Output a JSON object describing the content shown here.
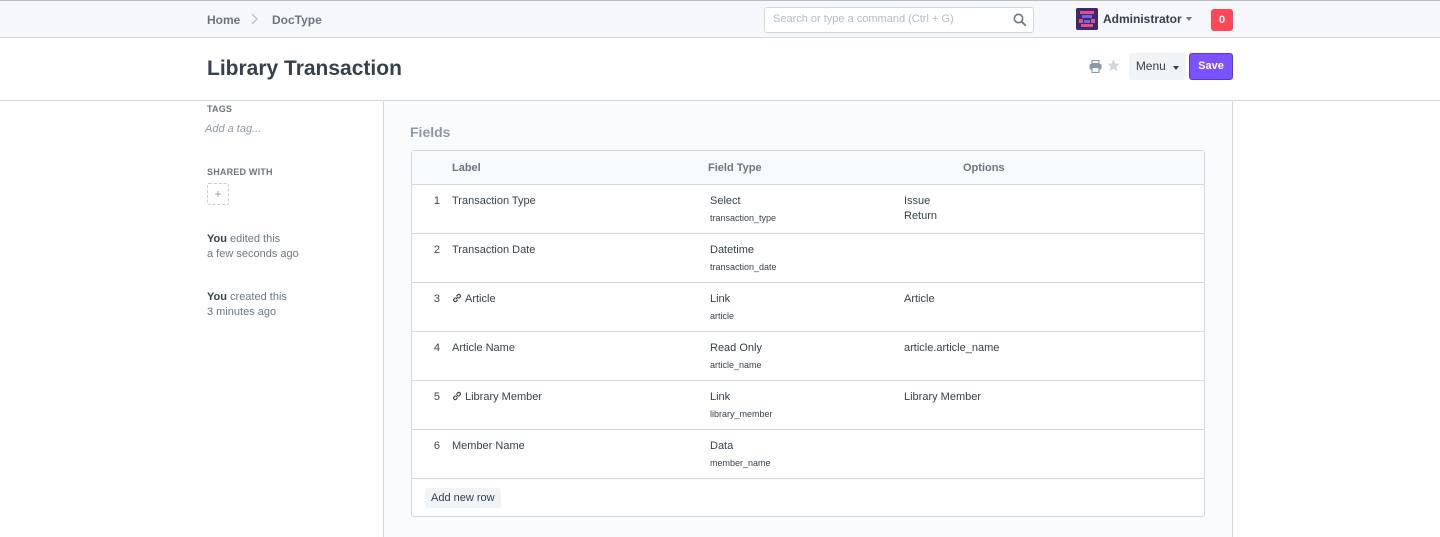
{
  "navbar": {
    "breadcrumbs": [
      "Home",
      "DocType"
    ],
    "search_placeholder": "Search or type a command (Ctrl + G)",
    "user_name": "Administrator",
    "notification_count": "0"
  },
  "page": {
    "title": "Library Transaction",
    "menu_label": "Menu",
    "save_label": "Save"
  },
  "sidebar": {
    "tags_label": "TAGS",
    "add_tag": "Add a tag...",
    "shared_label": "SHARED WITH",
    "share_add": "+",
    "timeline": [
      {
        "who": "You",
        "action": " edited this",
        "when": "a few seconds ago"
      },
      {
        "who": "You",
        "action": " created this",
        "when": "3 minutes ago"
      }
    ]
  },
  "fields": {
    "section_title": "Fields",
    "headers": {
      "label": "Label",
      "field_type": "Field Type",
      "options": "Options"
    },
    "rows": [
      {
        "idx": "1",
        "label": "Transaction Type",
        "is_link": false,
        "field_type": "Select",
        "fieldname": "transaction_type",
        "options": [
          "Issue",
          "Return"
        ]
      },
      {
        "idx": "2",
        "label": "Transaction Date",
        "is_link": false,
        "field_type": "Datetime",
        "fieldname": "transaction_date",
        "options": []
      },
      {
        "idx": "3",
        "label": "Article",
        "is_link": true,
        "field_type": "Link",
        "fieldname": "article",
        "options": [
          "Article"
        ]
      },
      {
        "idx": "4",
        "label": "Article Name",
        "is_link": false,
        "field_type": "Read Only",
        "fieldname": "article_name",
        "options": [
          "article.article_name"
        ]
      },
      {
        "idx": "5",
        "label": "Library Member",
        "is_link": true,
        "field_type": "Link",
        "fieldname": "library_member",
        "options": [
          "Library Member"
        ]
      },
      {
        "idx": "6",
        "label": "Member Name",
        "is_link": false,
        "field_type": "Data",
        "fieldname": "member_name",
        "options": []
      }
    ],
    "add_row_label": "Add new row"
  },
  "colors": {
    "primary": "#7a52ff",
    "notification": "#ff4756"
  }
}
